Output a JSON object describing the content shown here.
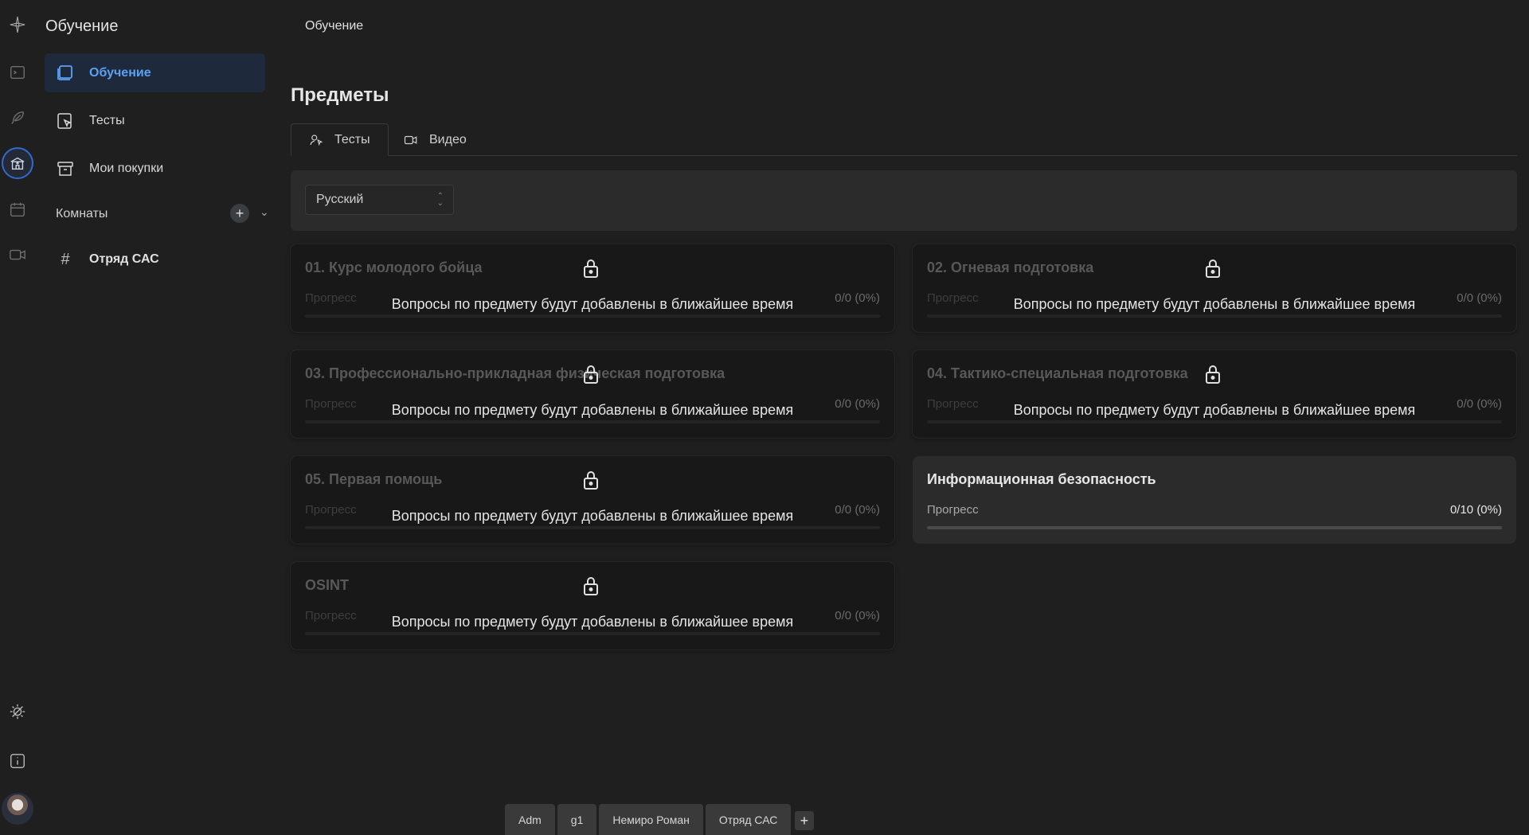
{
  "app": {
    "title": "Обучение"
  },
  "breadcrumb": "Обучение",
  "sidebar": {
    "items": [
      {
        "label": "Обучение",
        "icon": "book-icon",
        "active": true
      },
      {
        "label": "Тесты",
        "icon": "test-icon",
        "active": false
      },
      {
        "label": "Мои покупки",
        "icon": "archive-icon",
        "active": false
      }
    ],
    "rooms_label": "Комнаты",
    "rooms": [
      {
        "label": "Отряд САС"
      }
    ]
  },
  "rail": {
    "icons": [
      "logo-icon",
      "terminal-icon",
      "feather-icon",
      "school-icon",
      "calendar-icon",
      "video-icon",
      "theme-toggle-icon",
      "info-icon"
    ],
    "accent": "#2f6bd0"
  },
  "main": {
    "title": "Предметы",
    "tabs": [
      {
        "label": "Тесты",
        "icon": "tests-icon",
        "active": true
      },
      {
        "label": "Видео",
        "icon": "video-icon",
        "active": false
      }
    ],
    "language_select": {
      "value": "Русский"
    },
    "progress_label": "Прогресс",
    "locked_notice": "Вопросы по предмету будут добавлены в ближайшее время",
    "subjects": [
      {
        "title": "01. Курс молодого бойца",
        "progress": "0/0 (0%)",
        "locked": true,
        "fraction": 0
      },
      {
        "title": "02. Огневая подготовка",
        "progress": "0/0 (0%)",
        "locked": true,
        "fraction": 0
      },
      {
        "title": "03. Профессионально-прикладная физическая подготовка",
        "progress": "0/0 (0%)",
        "locked": true,
        "fraction": 0
      },
      {
        "title": "04. Тактико-специальная подготовка",
        "progress": "0/0 (0%)",
        "locked": true,
        "fraction": 0
      },
      {
        "title": "05. Первая помощь",
        "progress": "0/0 (0%)",
        "locked": true,
        "fraction": 0
      },
      {
        "title": "Информационная безопасность",
        "progress": "0/10 (0%)",
        "locked": false,
        "fraction": 0
      },
      {
        "title": "OSINT",
        "progress": "0/0 (0%)",
        "locked": true,
        "fraction": 0
      }
    ]
  },
  "bottom_tabs": [
    "Adm",
    "g1",
    "Немиро Роман",
    "Отряд САС"
  ],
  "bottom_add": "+",
  "rooms_add": "+"
}
